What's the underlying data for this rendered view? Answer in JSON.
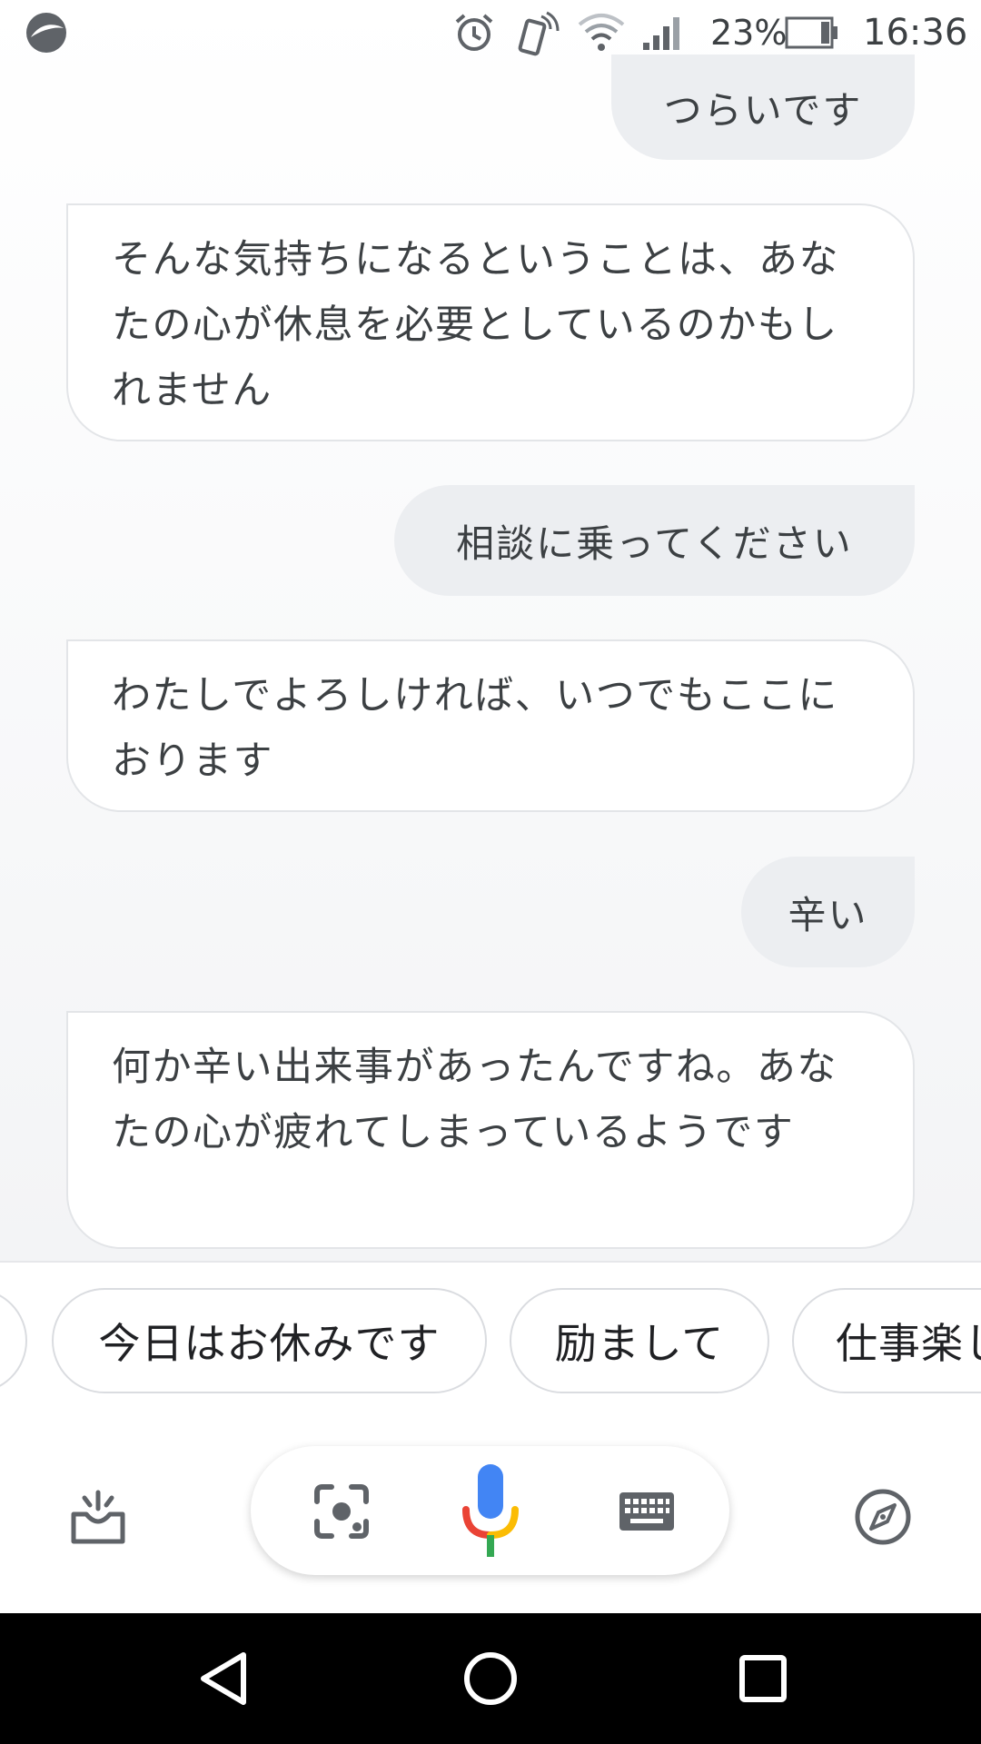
{
  "status_bar": {
    "battery": "23%",
    "time": "16:36",
    "icons": [
      "app-logo-icon",
      "alarm-icon",
      "vibrate-icon",
      "wifi-icon",
      "cell-signal-icon",
      "battery-icon"
    ]
  },
  "conversation": {
    "messages": [
      {
        "sender": "user",
        "text": "つらいです"
      },
      {
        "sender": "assistant",
        "text": "そんな気持ちになるということは、あなたの心が休息を必要としているのかもしれません"
      },
      {
        "sender": "user",
        "text": "相談に乗ってください"
      },
      {
        "sender": "assistant",
        "text": "わたしでよろしければ、いつでもここにおります"
      },
      {
        "sender": "user",
        "text": "辛い"
      },
      {
        "sender": "assistant",
        "text": "何か辛い出来事があったんですね。あなたの心が疲れてしまっているようです"
      }
    ]
  },
  "suggestions": {
    "chips": [
      "今日はお休みです",
      "励まして",
      "仕事楽し"
    ]
  },
  "input_bar": {
    "icons": [
      "updates-tray-icon",
      "lens-icon",
      "microphone-icon",
      "keyboard-icon",
      "explore-compass-icon"
    ]
  },
  "colors": {
    "mic_blue": "#4285f4",
    "mic_red": "#ea4335",
    "mic_yellow": "#fbbc04",
    "mic_green": "#34a853",
    "bubble_user": "#eceef1",
    "text": "#3c4043"
  },
  "nav_bar": {
    "icons": [
      "back-icon",
      "home-icon",
      "recents-icon"
    ]
  }
}
